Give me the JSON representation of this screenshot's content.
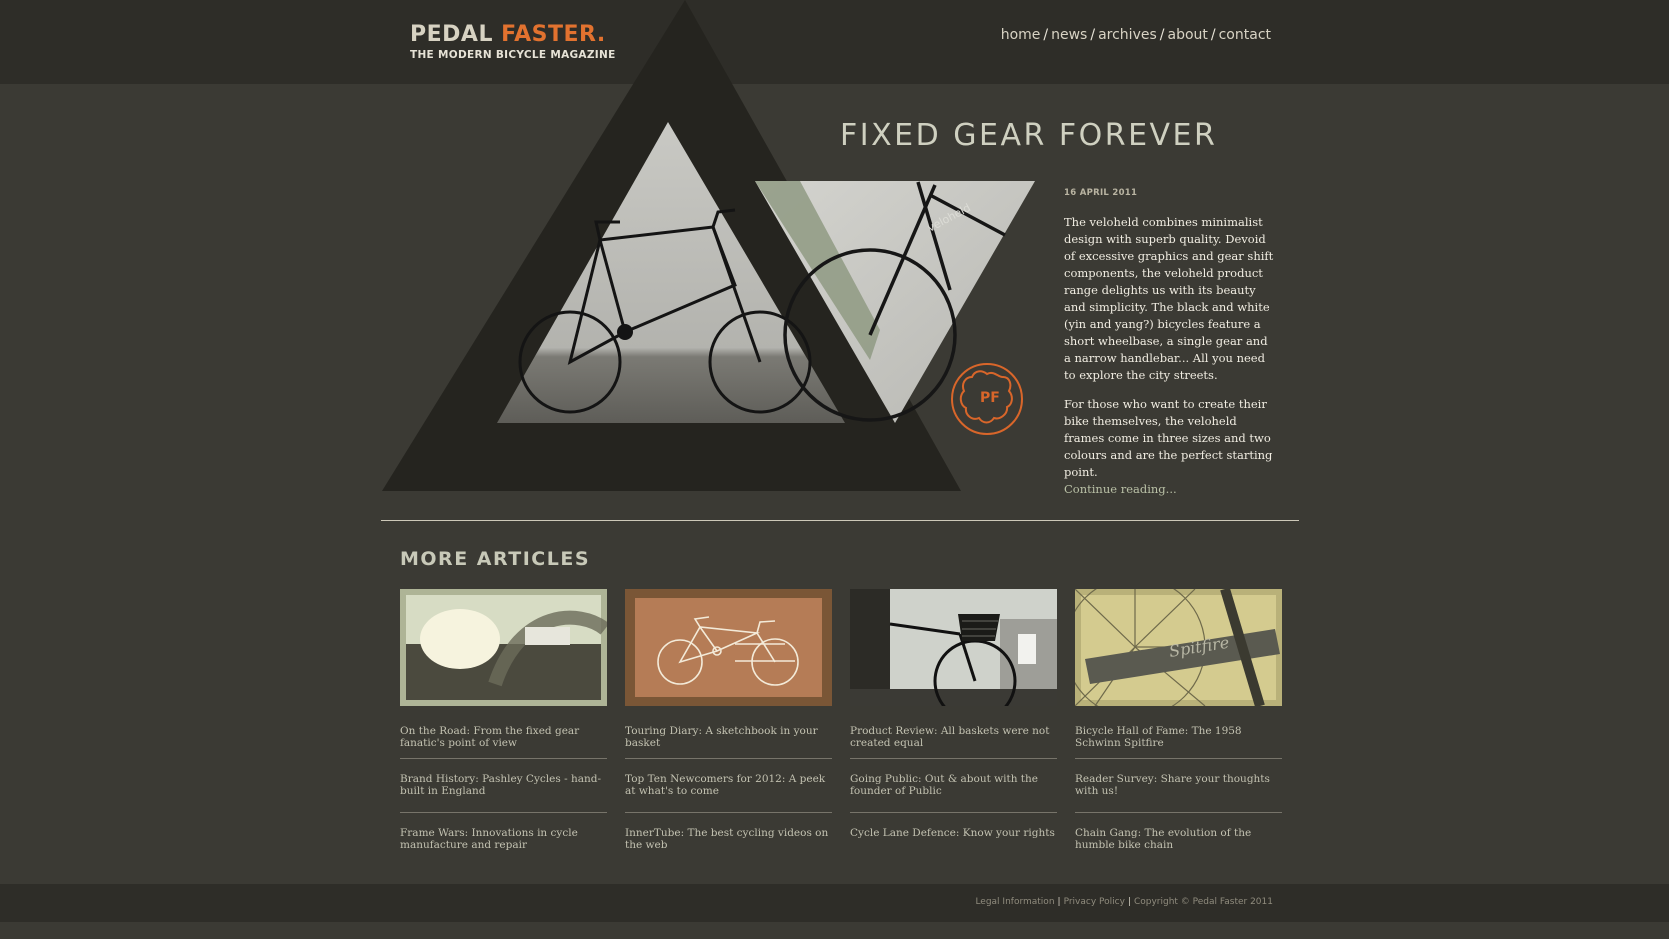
{
  "site": {
    "logo_word1": "PEDAL",
    "logo_word2": "FASTER.",
    "tagline": "THE MODERN BICYCLE MAGAZINE"
  },
  "nav": {
    "items": [
      {
        "label": "home"
      },
      {
        "label": "news"
      },
      {
        "label": "archives"
      },
      {
        "label": "about"
      },
      {
        "label": "contact"
      }
    ],
    "separator": "/"
  },
  "hero": {
    "title": "FIXED GEAR FOREVER",
    "date": "16 APRIL 2011",
    "paragraph1": "The veloheld combines minimalist design with superb quality. Devoid of excessive graphics and gear shift components, the veloheld product range delights us with its beauty and simplicity. The black and white (yin and yang?) bicycles feature a short wheelbase, a single gear and a narrow handlebar... All you need to explore the city streets.",
    "paragraph2": "For those who want to create their bike themselves, the veloheld frames come in three sizes and two colours and are the perfect starting point.",
    "continue": "Continue reading...",
    "badge_text": "PF",
    "frame_text": "veloheld"
  },
  "more": {
    "title": "MORE ARTICLES",
    "columns": [
      {
        "thumb_icon": "road-photo",
        "links": [
          "On the Road: From the fixed gear fanatic's point of view",
          "Brand History: Pashley Cycles - hand-built in England",
          "Frame Wars: Innovations in cycle manufacture and repair"
        ]
      },
      {
        "thumb_icon": "bicycle-sketch",
        "links": [
          "Touring Diary: A sketchbook in your basket",
          "Top Ten Newcomers for 2012: A peek at what's to come",
          "InnerTube: The best cycling videos on the web"
        ]
      },
      {
        "thumb_icon": "basket-photo",
        "links": [
          "Product Review: All baskets were not created equal",
          "Going Public: Out & about with the founder of Public",
          "Cycle Lane Defence: Know your rights"
        ]
      },
      {
        "thumb_icon": "schwinn-photo",
        "thumb_text": "Spitfire",
        "links": [
          "Bicycle Hall of Fame: The 1958 Schwinn Spitfire",
          "Reader Survey: Share your thoughts with us!",
          "Chain Gang: The evolution of the humble bike chain"
        ]
      }
    ]
  },
  "footer": {
    "legal": "Legal Information",
    "privacy": "Privacy Policy",
    "copyright": "Copyright © Pedal Faster 2011",
    "separator": "|"
  },
  "colors": {
    "background": "#3b3a34",
    "bar": "#2e2d28",
    "accent": "#e2722f",
    "triangle_dark": "#25241f"
  }
}
